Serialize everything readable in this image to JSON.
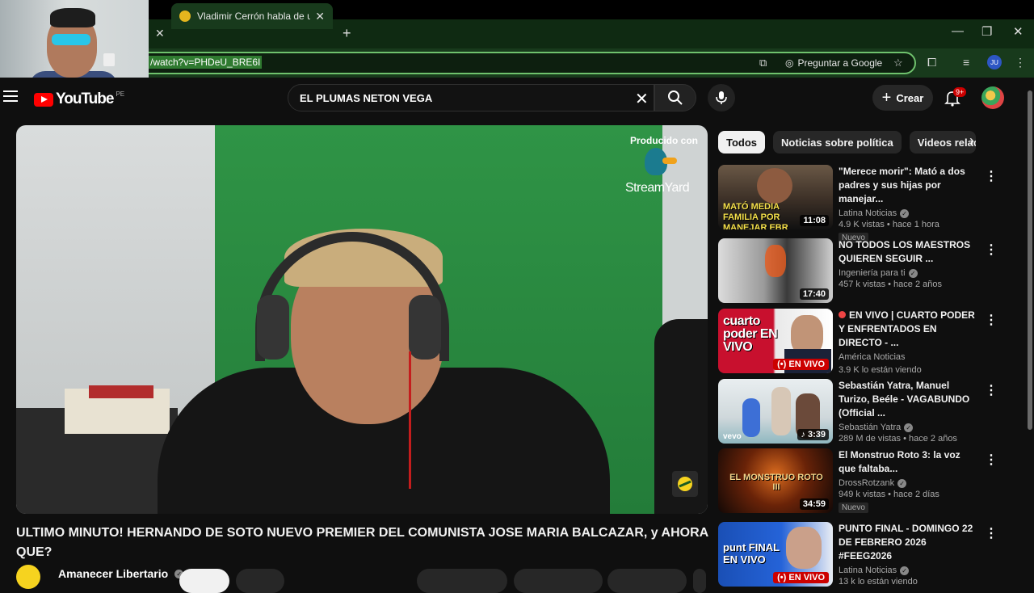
{
  "browser": {
    "tab_title": "Vladimir Cerrón habla de un \"fr",
    "url": "/watch?v=PHDeU_BRE6I",
    "ask_google": "Preguntar a Google",
    "profile_initials": "JU"
  },
  "header": {
    "logo_text": "YouTube",
    "country_code": "PE",
    "search_query": "EL PLUMAS NETON VEGA",
    "create_label": "Crear",
    "notification_count": "9+"
  },
  "video": {
    "overlay_label": "Producido con",
    "overlay_brand": "StreamYard",
    "title": "ULTIMO MINUTO! HERNANDO DE SOTO NUEVO PREMIER DEL COMUNISTA JOSE MARIA BALCAZAR, y AHORA QUE?",
    "channel": "Amanecer Libertario"
  },
  "chips": [
    {
      "label": "Todos"
    },
    {
      "label": "Noticias sobre política"
    },
    {
      "label": "Videos relacionados"
    }
  ],
  "recommendations": [
    {
      "title": "\"Merece morir\": Mató a dos padres y sus hijas por manejar...",
      "channel": "Latina Noticias",
      "stats": "4.9 K vistas • hace 1 hora",
      "duration": "11:08",
      "badge": "Nuevo",
      "thumb_text": "MATÓ MEDIA FAMILIA POR MANEJAR EBR"
    },
    {
      "title": "NO TODOS LOS MAESTROS QUIEREN SEGUIR ...",
      "channel": "Ingeniería para ti",
      "stats": "457 k vistas • hace 2 años",
      "duration": "17:40"
    },
    {
      "title": "EN VIVO | CUARTO PODER Y ENFRENTADOS EN DIRECTO - ...",
      "channel": "América Noticias",
      "stats": "3.9 K lo están viendo",
      "live_label": "EN VIVO",
      "thumb_text": "cuarto poder EN VIVO"
    },
    {
      "title": "Sebastián Yatra, Manuel Turizo, Beéle - VAGABUNDO (Official ...",
      "channel": "Sebastián Yatra",
      "stats": "289 M de vistas • hace 2 años",
      "duration": "3:39",
      "thumb_text": "vevo"
    },
    {
      "title": "El Monstruo Roto 3: la voz que faltaba...",
      "channel": "DrossRotzank",
      "stats": "949 k vistas • hace 2 días",
      "duration": "34:59",
      "badge": "Nuevo",
      "thumb_text": "EL MONSTRUO ROTO III"
    },
    {
      "title": "PUNTO FINAL - DOMINGO 22 DE FEBRERO 2026 #FEEG2026",
      "channel": "Latina Noticias",
      "stats": "13 k lo están viendo",
      "live_label": "EN VIVO",
      "thumb_text": "punt FINAL EN VIVO"
    }
  ]
}
